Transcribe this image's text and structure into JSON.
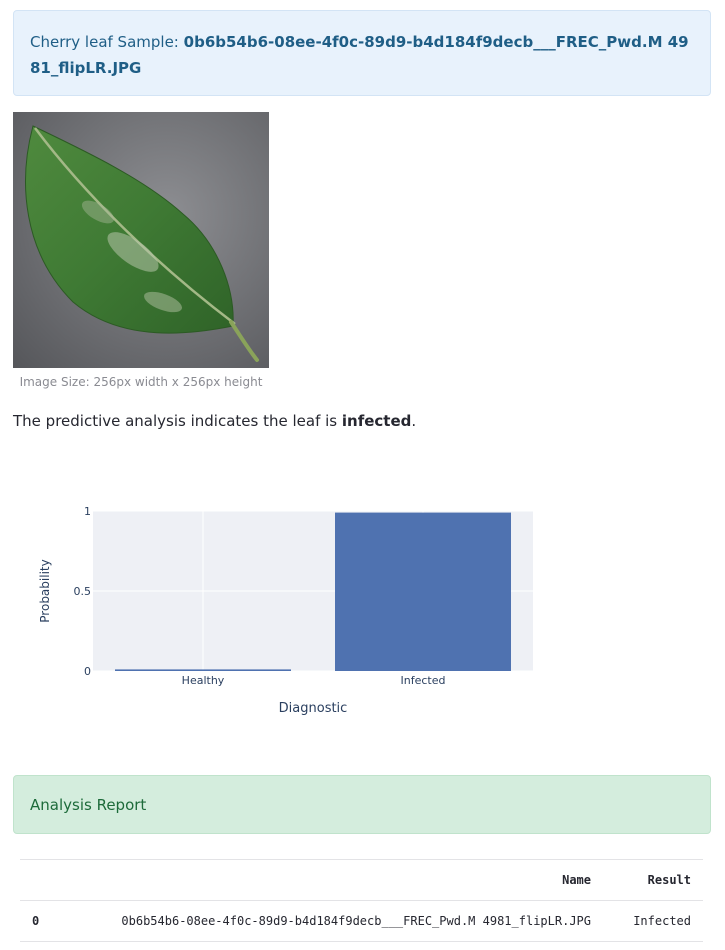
{
  "sample": {
    "label": "Cherry leaf Sample: ",
    "filename": "0b6b54b6-08ee-4f0c-89d9-b4d184f9decb___FREC_Pwd.M 4981_flipLR.JPG"
  },
  "image": {
    "caption": "Image Size: 256px width x 256px height"
  },
  "verdict": {
    "prefix": "The predictive analysis indicates the leaf is ",
    "result": "infected",
    "suffix": "."
  },
  "chart_data": {
    "type": "bar",
    "categories": [
      "Healthy",
      "Infected"
    ],
    "values": [
      0.01,
      0.99
    ],
    "xlabel": "Diagnostic",
    "ylabel": "Probability",
    "ylim": [
      0,
      1
    ],
    "yticks": [
      "0",
      "0.5",
      "1"
    ],
    "bar_color": "#4f72b0",
    "plot_bg": "#eef0f5",
    "grid": true
  },
  "report": {
    "title": "Analysis Report",
    "columns": [
      "",
      "Name",
      "Result"
    ],
    "rows": [
      [
        "0",
        "0b6b54b6-08ee-4f0c-89d9-b4d184f9decb___FREC_Pwd.M 4981_flipLR.JPG",
        "Infected"
      ]
    ]
  }
}
